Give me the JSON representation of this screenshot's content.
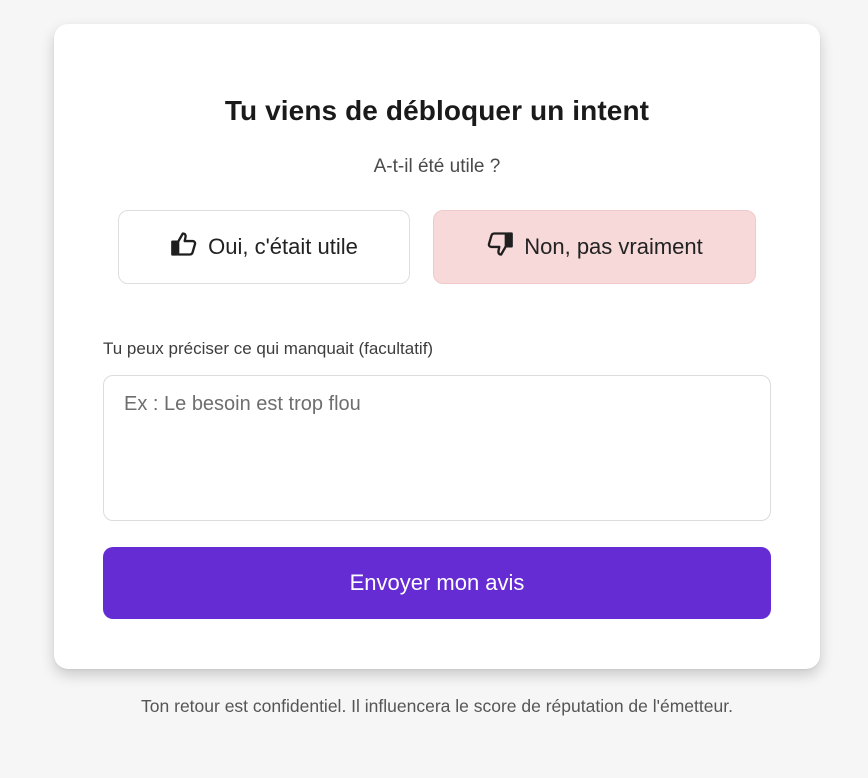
{
  "card": {
    "title": "Tu viens de débloquer un intent",
    "subtitle": "A-t-il été utile ?",
    "choices": {
      "yes": {
        "label": "Oui, c'était utile",
        "icon": "thumbs-up-icon",
        "selected": false
      },
      "no": {
        "label": "Non, pas vraiment",
        "icon": "thumbs-down-icon",
        "selected": true,
        "color": "#f7d9d9"
      }
    },
    "feedback": {
      "label": "Tu peux préciser ce qui manquait (facultatif)",
      "placeholder": "Ex : Le besoin est trop flou",
      "value": ""
    },
    "submit_label": "Envoyer mon avis",
    "accent_color": "#662cd4"
  },
  "footer": {
    "note": "Ton retour est confidentiel. Il influencera le score de réputation de l'émetteur."
  }
}
